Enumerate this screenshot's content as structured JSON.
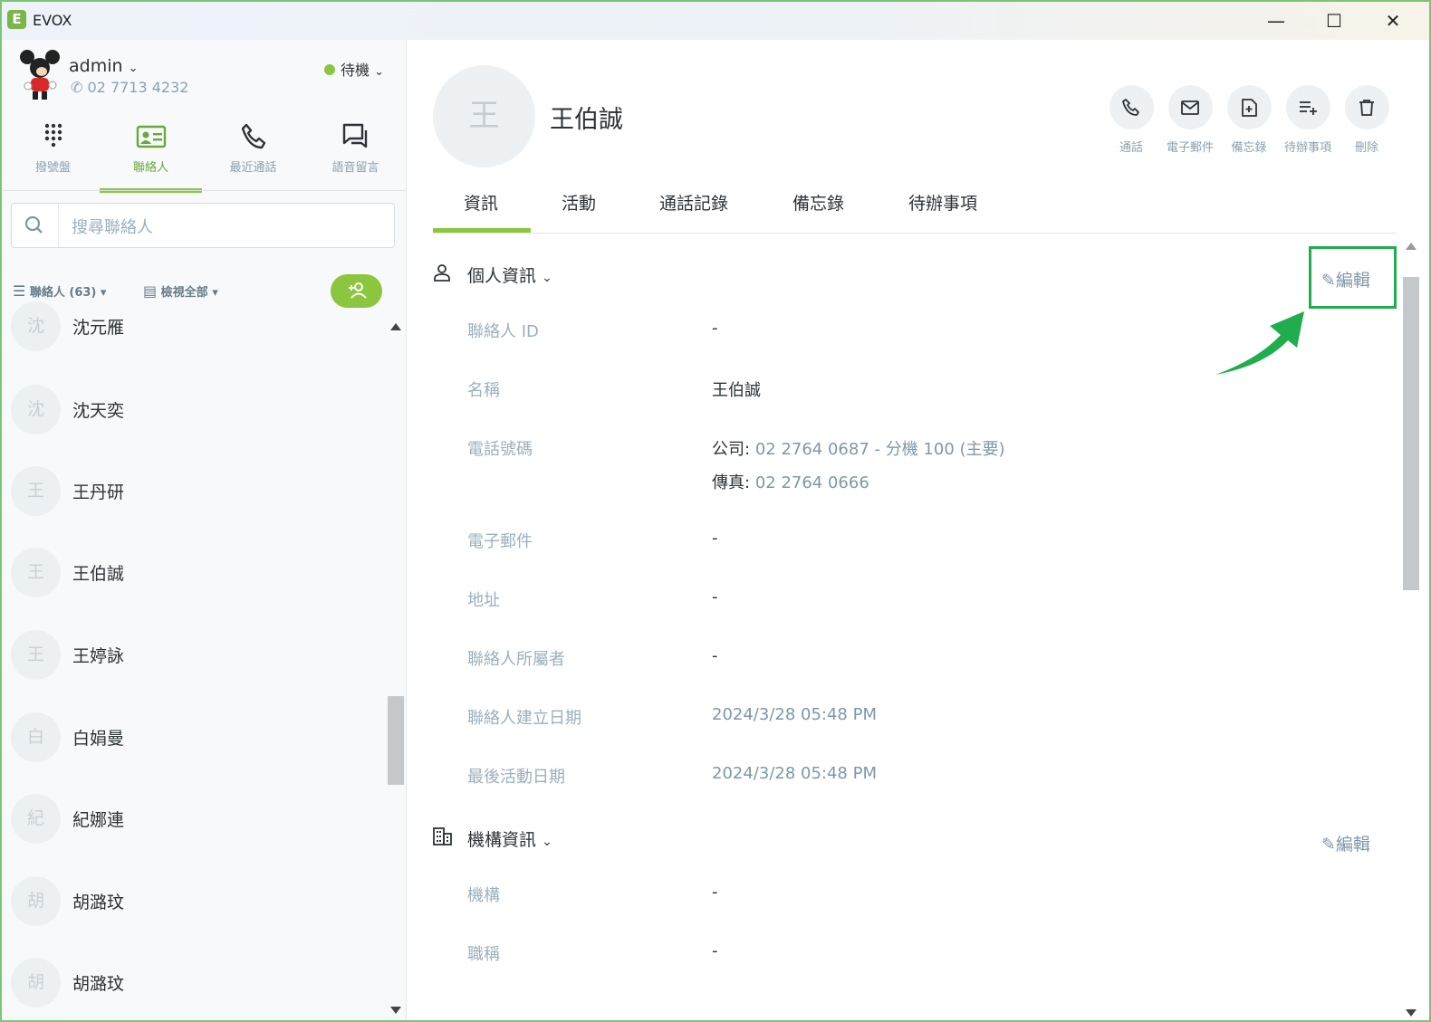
{
  "window": {
    "title": "EVOX",
    "logo_letter": "E",
    "minimize": "—",
    "maximize": "☐",
    "close": "✕"
  },
  "user": {
    "name": "admin",
    "phone": "02 7713 4232",
    "status": "待機"
  },
  "nav_tabs": [
    {
      "label": "撥號盤",
      "icon": "dialpad-icon"
    },
    {
      "label": "聯絡人",
      "icon": "contact-card-icon",
      "active": true
    },
    {
      "label": "最近通話",
      "icon": "phone-icon"
    },
    {
      "label": "語音留言",
      "icon": "voicemail-icon"
    }
  ],
  "search": {
    "placeholder": "搜尋聯絡人"
  },
  "filters": {
    "contacts": "聯絡人 (63)",
    "view": "檢視全部"
  },
  "contacts": [
    {
      "initial": "沈",
      "name": "沈元雁"
    },
    {
      "initial": "沈",
      "name": "沈天奕"
    },
    {
      "initial": "王",
      "name": "王丹研"
    },
    {
      "initial": "王",
      "name": "王伯誠"
    },
    {
      "initial": "王",
      "name": "王婷詠"
    },
    {
      "initial": "白",
      "name": "白娟曼"
    },
    {
      "initial": "紀",
      "name": "紀娜連"
    },
    {
      "initial": "胡",
      "name": "胡潞玟"
    },
    {
      "initial": "胡",
      "name": "胡潞玟"
    }
  ],
  "detail": {
    "initial": "王",
    "name": "王伯誠",
    "actions": [
      "通話",
      "電子郵件",
      "備忘錄",
      "待辦事項",
      "刪除"
    ],
    "tabs": [
      "資訊",
      "活動",
      "通話記錄",
      "備忘錄",
      "待辦事項"
    ],
    "personal_section": "個人資訊",
    "edit_label": "編輯",
    "fields": {
      "contact_id_label": "聯絡人 ID",
      "contact_id": "-",
      "name_label": "名稱",
      "name": "王伯誠",
      "phone_label": "電話號碼",
      "phone_office_prefix": "公司:",
      "phone_office": "02 2764 0687 - 分機 100 (主要)",
      "phone_fax_prefix": "傳真:",
      "phone_fax": "02 2764 0666",
      "email_label": "電子郵件",
      "email": "-",
      "address_label": "地址",
      "address": "-",
      "owner_label": "聯絡人所屬者",
      "owner": "-",
      "created_label": "聯絡人建立日期",
      "created": "2024/3/28 05:48 PM",
      "last_activity_label": "最後活動日期",
      "last_activity": "2024/3/28 05:48 PM"
    },
    "org_section": "機構資訊",
    "org_fields": {
      "org_label": "機構",
      "org": "-",
      "title_label": "職稱",
      "title": "-"
    }
  },
  "colors": {
    "accent": "#8cc63e",
    "highlight": "#1fad4d",
    "label": "#9ab0bd"
  }
}
